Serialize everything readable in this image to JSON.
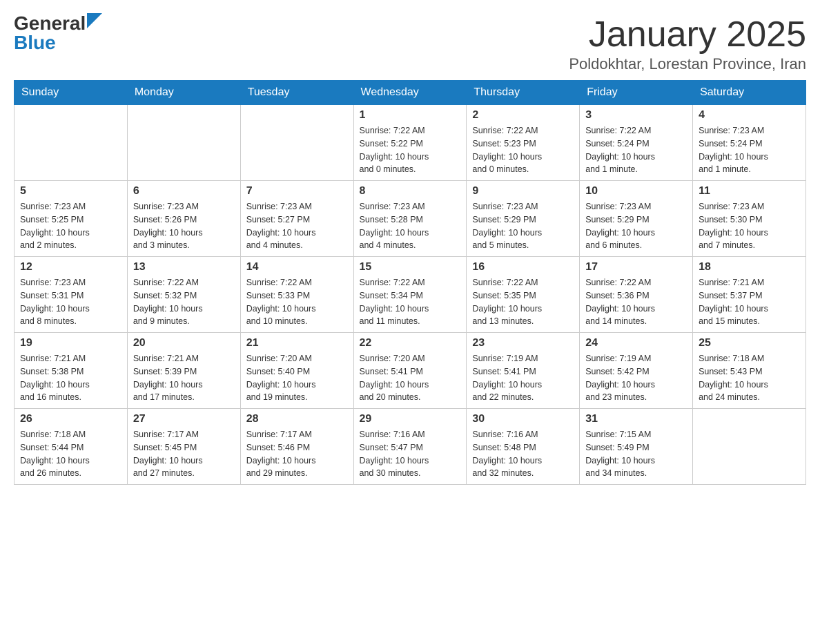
{
  "header": {
    "logo_general": "General",
    "logo_blue": "Blue",
    "month_title": "January 2025",
    "location": "Poldokhtar, Lorestan Province, Iran"
  },
  "days_of_week": [
    "Sunday",
    "Monday",
    "Tuesday",
    "Wednesday",
    "Thursday",
    "Friday",
    "Saturday"
  ],
  "weeks": [
    [
      {
        "day": "",
        "info": ""
      },
      {
        "day": "",
        "info": ""
      },
      {
        "day": "",
        "info": ""
      },
      {
        "day": "1",
        "info": "Sunrise: 7:22 AM\nSunset: 5:22 PM\nDaylight: 10 hours\nand 0 minutes."
      },
      {
        "day": "2",
        "info": "Sunrise: 7:22 AM\nSunset: 5:23 PM\nDaylight: 10 hours\nand 0 minutes."
      },
      {
        "day": "3",
        "info": "Sunrise: 7:22 AM\nSunset: 5:24 PM\nDaylight: 10 hours\nand 1 minute."
      },
      {
        "day": "4",
        "info": "Sunrise: 7:23 AM\nSunset: 5:24 PM\nDaylight: 10 hours\nand 1 minute."
      }
    ],
    [
      {
        "day": "5",
        "info": "Sunrise: 7:23 AM\nSunset: 5:25 PM\nDaylight: 10 hours\nand 2 minutes."
      },
      {
        "day": "6",
        "info": "Sunrise: 7:23 AM\nSunset: 5:26 PM\nDaylight: 10 hours\nand 3 minutes."
      },
      {
        "day": "7",
        "info": "Sunrise: 7:23 AM\nSunset: 5:27 PM\nDaylight: 10 hours\nand 4 minutes."
      },
      {
        "day": "8",
        "info": "Sunrise: 7:23 AM\nSunset: 5:28 PM\nDaylight: 10 hours\nand 4 minutes."
      },
      {
        "day": "9",
        "info": "Sunrise: 7:23 AM\nSunset: 5:29 PM\nDaylight: 10 hours\nand 5 minutes."
      },
      {
        "day": "10",
        "info": "Sunrise: 7:23 AM\nSunset: 5:29 PM\nDaylight: 10 hours\nand 6 minutes."
      },
      {
        "day": "11",
        "info": "Sunrise: 7:23 AM\nSunset: 5:30 PM\nDaylight: 10 hours\nand 7 minutes."
      }
    ],
    [
      {
        "day": "12",
        "info": "Sunrise: 7:23 AM\nSunset: 5:31 PM\nDaylight: 10 hours\nand 8 minutes."
      },
      {
        "day": "13",
        "info": "Sunrise: 7:22 AM\nSunset: 5:32 PM\nDaylight: 10 hours\nand 9 minutes."
      },
      {
        "day": "14",
        "info": "Sunrise: 7:22 AM\nSunset: 5:33 PM\nDaylight: 10 hours\nand 10 minutes."
      },
      {
        "day": "15",
        "info": "Sunrise: 7:22 AM\nSunset: 5:34 PM\nDaylight: 10 hours\nand 11 minutes."
      },
      {
        "day": "16",
        "info": "Sunrise: 7:22 AM\nSunset: 5:35 PM\nDaylight: 10 hours\nand 13 minutes."
      },
      {
        "day": "17",
        "info": "Sunrise: 7:22 AM\nSunset: 5:36 PM\nDaylight: 10 hours\nand 14 minutes."
      },
      {
        "day": "18",
        "info": "Sunrise: 7:21 AM\nSunset: 5:37 PM\nDaylight: 10 hours\nand 15 minutes."
      }
    ],
    [
      {
        "day": "19",
        "info": "Sunrise: 7:21 AM\nSunset: 5:38 PM\nDaylight: 10 hours\nand 16 minutes."
      },
      {
        "day": "20",
        "info": "Sunrise: 7:21 AM\nSunset: 5:39 PM\nDaylight: 10 hours\nand 17 minutes."
      },
      {
        "day": "21",
        "info": "Sunrise: 7:20 AM\nSunset: 5:40 PM\nDaylight: 10 hours\nand 19 minutes."
      },
      {
        "day": "22",
        "info": "Sunrise: 7:20 AM\nSunset: 5:41 PM\nDaylight: 10 hours\nand 20 minutes."
      },
      {
        "day": "23",
        "info": "Sunrise: 7:19 AM\nSunset: 5:41 PM\nDaylight: 10 hours\nand 22 minutes."
      },
      {
        "day": "24",
        "info": "Sunrise: 7:19 AM\nSunset: 5:42 PM\nDaylight: 10 hours\nand 23 minutes."
      },
      {
        "day": "25",
        "info": "Sunrise: 7:18 AM\nSunset: 5:43 PM\nDaylight: 10 hours\nand 24 minutes."
      }
    ],
    [
      {
        "day": "26",
        "info": "Sunrise: 7:18 AM\nSunset: 5:44 PM\nDaylight: 10 hours\nand 26 minutes."
      },
      {
        "day": "27",
        "info": "Sunrise: 7:17 AM\nSunset: 5:45 PM\nDaylight: 10 hours\nand 27 minutes."
      },
      {
        "day": "28",
        "info": "Sunrise: 7:17 AM\nSunset: 5:46 PM\nDaylight: 10 hours\nand 29 minutes."
      },
      {
        "day": "29",
        "info": "Sunrise: 7:16 AM\nSunset: 5:47 PM\nDaylight: 10 hours\nand 30 minutes."
      },
      {
        "day": "30",
        "info": "Sunrise: 7:16 AM\nSunset: 5:48 PM\nDaylight: 10 hours\nand 32 minutes."
      },
      {
        "day": "31",
        "info": "Sunrise: 7:15 AM\nSunset: 5:49 PM\nDaylight: 10 hours\nand 34 minutes."
      },
      {
        "day": "",
        "info": ""
      }
    ]
  ]
}
